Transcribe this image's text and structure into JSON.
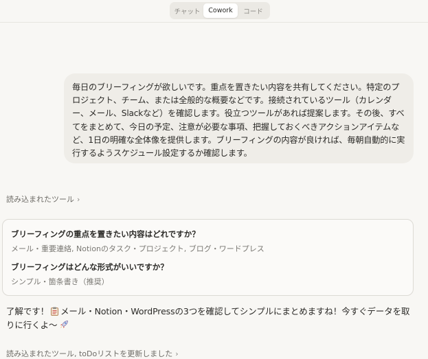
{
  "header": {
    "tabs": [
      {
        "label": "チャット"
      },
      {
        "label": "Cowork"
      },
      {
        "label": "コード"
      }
    ]
  },
  "user_message": {
    "text": "毎日のブリーフィングが欲しいです。重点を置きたい内容を共有してください。特定のプロジェクト、チーム、または全般的な概要などです。接続されているツール（カレンダー、メール、Slackなど）を確認します。役立つツールがあれば提案します。その後、すべてをまとめて、今日の予定、注意が必要な事項、把握しておくべきアクションアイテムなど、1日の明確な全体像を提供します。ブリーフィングの内容が良ければ、毎朝自動的に実行するようスケジュール設定するか確認します。"
  },
  "tools_loaded_1": {
    "label": "読み込まれたツール",
    "chevron": "›"
  },
  "questions": [
    {
      "title": "ブリーフィングの重点を置きたい内容はどれですか？",
      "answer": "メール・重要連絡, Notionのタスク・プロジェクト, ブログ・ワードプレス"
    },
    {
      "title": "ブリーフィングはどんな形式がいいですか？",
      "answer": "シンプル・箇条書き（推奨）"
    }
  ],
  "assistant_message": {
    "part1": "了解です！",
    "part2": "メール・Notion・WordPressの3つを確認してシンプルにまとめますね！今すぐデータを取りに行くよ〜",
    "icons": [
      "clipboard-icon",
      "rocket-icon"
    ]
  },
  "tools_loaded_2": {
    "label": "読み込まれたツール, toDoリストを更新しました",
    "chevron": "›"
  }
}
